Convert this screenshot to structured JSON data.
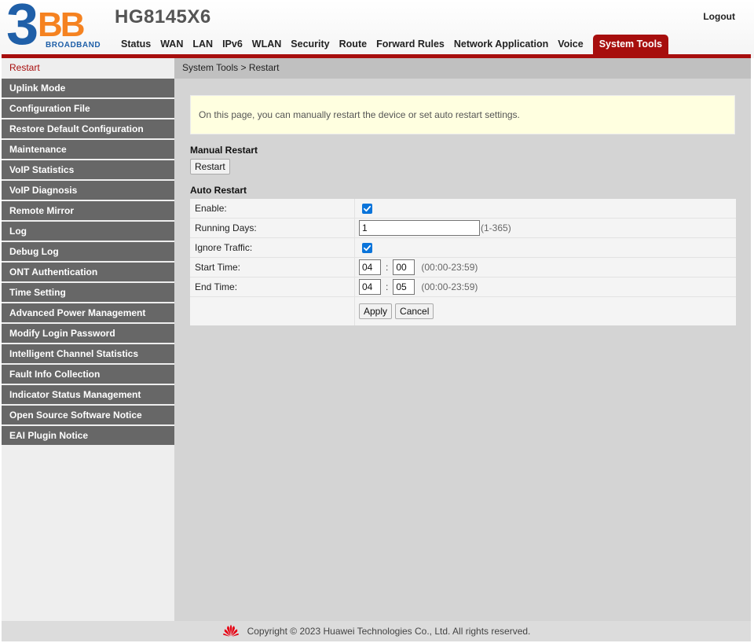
{
  "header": {
    "logo_main": "3BB",
    "logo_sub": "BROADBAND",
    "model": "HG8145X6",
    "logout": "Logout"
  },
  "nav": {
    "items": [
      "Status",
      "WAN",
      "LAN",
      "IPv6",
      "WLAN",
      "Security",
      "Route",
      "Forward Rules",
      "Network Application",
      "Voice",
      "System Tools"
    ],
    "active": "System Tools"
  },
  "sidebar": {
    "items": [
      "Restart",
      "Uplink Mode",
      "Configuration File",
      "Restore Default Configuration",
      "Maintenance",
      "VoIP Statistics",
      "VoIP Diagnosis",
      "Remote Mirror",
      "Log",
      "Debug Log",
      "ONT Authentication",
      "Time Setting",
      "Advanced Power Management",
      "Modify Login Password",
      "Intelligent Channel Statistics",
      "Fault Info Collection",
      "Indicator Status Management",
      "Open Source Software Notice",
      "EAI Plugin Notice"
    ],
    "active": "Restart"
  },
  "main": {
    "breadcrumb": "System Tools > Restart",
    "notice": "On this page, you can manually restart the device or set auto restart settings.",
    "manual_title": "Manual Restart",
    "restart_button": "Restart",
    "auto_title": "Auto Restart",
    "form": {
      "enable_label": "Enable:",
      "enable_checked": true,
      "running_days_label": "Running Days:",
      "running_days_value": "1",
      "running_days_hint": "(1-365)",
      "ignore_traffic_label": "Ignore Traffic:",
      "ignore_traffic_checked": true,
      "start_time_label": "Start Time:",
      "start_hour": "04",
      "start_minute": "00",
      "end_time_label": "End Time:",
      "end_hour": "04",
      "end_minute": "05",
      "time_separator": ":",
      "time_hint": "(00:00-23:59)",
      "apply_button": "Apply",
      "cancel_button": "Cancel"
    }
  },
  "footer": {
    "copyright": "Copyright © 2023 Huawei Technologies Co., Ltd. All rights reserved."
  },
  "colors": {
    "accent": "#a70e0d",
    "sidebar_item": "#676767",
    "checkbox": "#0a74da",
    "notice_bg": "#ffffe0"
  }
}
